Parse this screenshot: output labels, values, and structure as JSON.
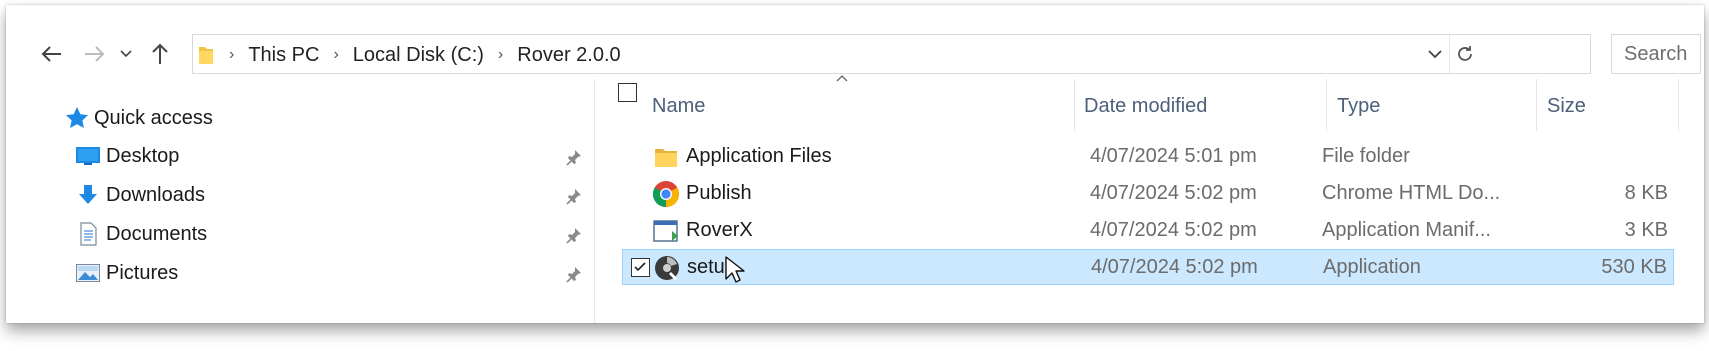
{
  "nav": {
    "back_icon": "back-arrow-icon",
    "forward_icon": "forward-arrow-icon",
    "recent_icon": "chevron-down-icon",
    "up_icon": "up-arrow-icon"
  },
  "address": {
    "crumbs": [
      "This PC",
      "Local Disk (C:)",
      "Rover 2.0.0"
    ],
    "refresh_icon": "refresh-icon"
  },
  "search": {
    "placeholder": "Search"
  },
  "sidebar": {
    "items": [
      {
        "label": "Quick access",
        "icon": "star-icon"
      },
      {
        "label": "Desktop",
        "icon": "desktop-icon"
      },
      {
        "label": "Downloads",
        "icon": "download-icon"
      },
      {
        "label": "Documents",
        "icon": "documents-icon"
      },
      {
        "label": "Pictures",
        "icon": "pictures-icon"
      }
    ]
  },
  "columns": {
    "name": "Name",
    "date": "Date modified",
    "type": "Type",
    "size": "Size"
  },
  "files": [
    {
      "name": "Application Files",
      "date": "4/07/2024 5:01 pm",
      "type": "File folder",
      "size": "",
      "icon": "folder-icon"
    },
    {
      "name": "Publish",
      "date": "4/07/2024 5:02 pm",
      "type": "Chrome HTML Do...",
      "size": "8 KB",
      "icon": "chrome-icon"
    },
    {
      "name": "RoverX",
      "date": "4/07/2024 5:02 pm",
      "type": "Application Manif...",
      "size": "3 KB",
      "icon": "manifest-icon"
    },
    {
      "name": "setup",
      "date": "4/07/2024 5:02 pm",
      "type": "Application",
      "size": "530 KB",
      "icon": "setup-icon",
      "selected": true
    }
  ]
}
